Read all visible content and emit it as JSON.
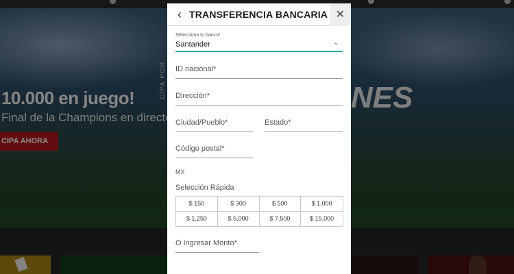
{
  "background": {
    "hero_title": "10.000 en juego!",
    "hero_subtitle": "Final de la Champions en directo",
    "hero_button": "CIPA AHORA",
    "hero_right": "NES",
    "hero_vertical": "CIPA POR"
  },
  "modal": {
    "title": "TRANSFERENCIA BANCARIA",
    "back_icon": "chevron-left-icon",
    "close_icon": "close-icon",
    "bank_select": {
      "label": "Selecciona tu banco*",
      "value": "Santander",
      "accent_color": "#2fae9b"
    },
    "fields": {
      "national_id": "ID nacional*",
      "address": "Dirección*",
      "city": "Ciudad/Pueblo*",
      "state": "Estado*",
      "postal_code": "Código postal*"
    },
    "country": "MX",
    "quick_select_label": "Selección Rápida",
    "amounts": [
      "$ 150",
      "$ 300",
      "$ 500",
      "$ 1,000",
      "$ 1,250",
      "$ 5,000",
      "$ 7,500",
      "$ 15,000"
    ],
    "amount_input_label": "O Ingresar Monto*"
  }
}
